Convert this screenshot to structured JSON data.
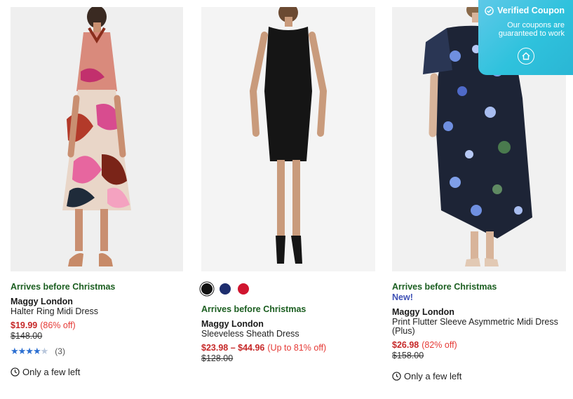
{
  "products": [
    {
      "image_alt": "Halter Ring Midi Dress",
      "arrives": "Arrives before Christmas",
      "brand": "Maggy London",
      "name": "Halter Ring Midi Dress",
      "price": "$19.99",
      "discount": "(86% off)",
      "was_price": "$148.00",
      "rating_value": 4.5,
      "rating_count": "(3)",
      "stock": "Only a few left"
    },
    {
      "image_alt": "Sleeveless Sheath Dress",
      "swatches": [
        {
          "color": "#111111",
          "selected": true
        },
        {
          "color": "#1e2e6e",
          "selected": false
        },
        {
          "color": "#d0152f",
          "selected": false
        }
      ],
      "arrives": "Arrives before Christmas",
      "brand": "Maggy London",
      "name": "Sleeveless Sheath Dress",
      "price": "$23.98 – $44.96",
      "discount": "(Up to 81% off)",
      "was_price": "$128.00"
    },
    {
      "image_alt": "Print Flutter Sleeve Asymmetric Midi Dress (Plus)",
      "arrives": "Arrives before Christmas",
      "new_label": "New!",
      "brand": "Maggy London",
      "name": "Print Flutter Sleeve Asymmetric Midi Dress (Plus)",
      "price": "$26.98",
      "discount": "(82% off)",
      "was_price": "$158.00",
      "stock": "Only a few left"
    }
  ],
  "coupon": {
    "title": "Verified Coupon",
    "subtitle": "Our coupons are guaranteed to work"
  },
  "colors": {
    "arrives_green": "#1b5e20",
    "price_red": "#c62828",
    "new_blue": "#3f51b5",
    "star_blue": "#2c6fd1",
    "coupon_teal": "#2fc2dd"
  }
}
